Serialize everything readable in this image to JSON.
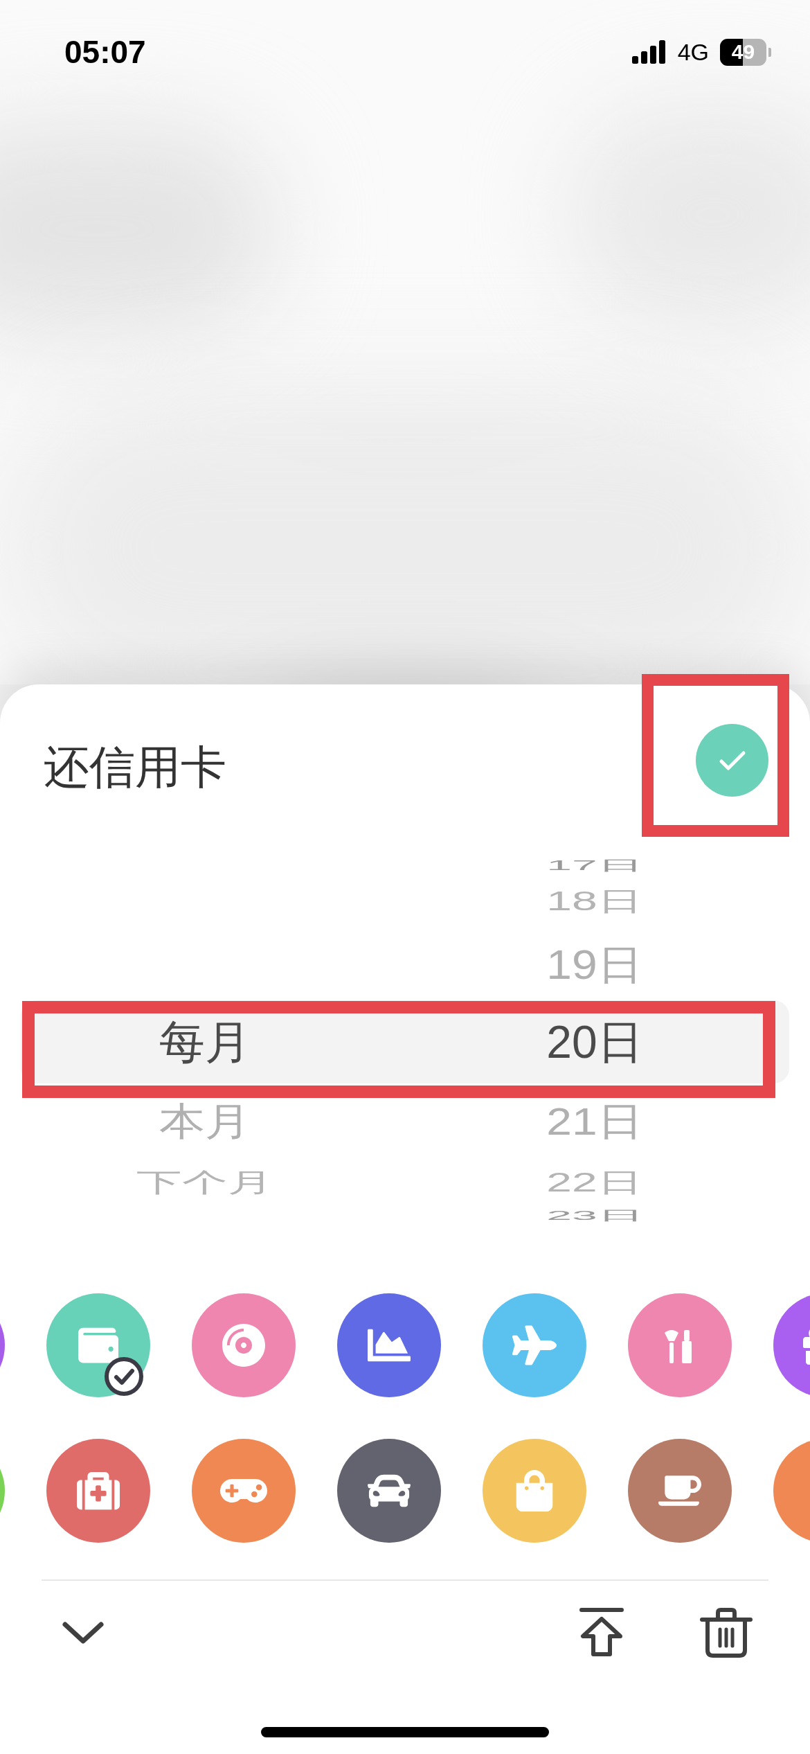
{
  "status_bar": {
    "time": "05:07",
    "network": "4G",
    "battery": "49"
  },
  "sheet": {
    "title": "还信用卡"
  },
  "picker": {
    "columns": [
      {
        "items": [
          {
            "label": "每月",
            "selected": true
          },
          {
            "label": "本月",
            "selected": false
          },
          {
            "label": "下个月",
            "selected": false
          }
        ]
      },
      {
        "items": [
          {
            "label": "17日",
            "selected": false
          },
          {
            "label": "18日",
            "selected": false
          },
          {
            "label": "19日",
            "selected": false
          },
          {
            "label": "20日",
            "selected": true
          },
          {
            "label": "21日",
            "selected": false
          },
          {
            "label": "22日",
            "selected": false
          },
          {
            "label": "23日",
            "selected": false
          }
        ]
      }
    ]
  },
  "categories": {
    "rows": [
      [
        {
          "kind": "edge",
          "color": "#a65eea",
          "selected": false
        },
        {
          "kind": "wallet",
          "color": "#68d2b9",
          "selected": true
        },
        {
          "kind": "disc",
          "color": "#ee86b0",
          "selected": false
        },
        {
          "kind": "chart",
          "color": "#5f6ae4",
          "selected": false
        },
        {
          "kind": "plane",
          "color": "#5bc2f0",
          "selected": false
        },
        {
          "kind": "makeup",
          "color": "#ee86b0",
          "selected": false
        },
        {
          "kind": "gift",
          "color": "#a95ff0",
          "selected": false
        }
      ],
      [
        {
          "kind": "edge",
          "color": "#7ad353",
          "selected": false
        },
        {
          "kind": "medicine",
          "color": "#e06c6a",
          "selected": false
        },
        {
          "kind": "gamepad",
          "color": "#ef8852",
          "selected": false
        },
        {
          "kind": "car",
          "color": "#62636f",
          "selected": false
        },
        {
          "kind": "bag",
          "color": "#f4c55e",
          "selected": false
        },
        {
          "kind": "cup",
          "color": "#b77c67",
          "selected": false
        },
        {
          "kind": "edge",
          "color": "#ef8852",
          "selected": false
        }
      ]
    ]
  }
}
